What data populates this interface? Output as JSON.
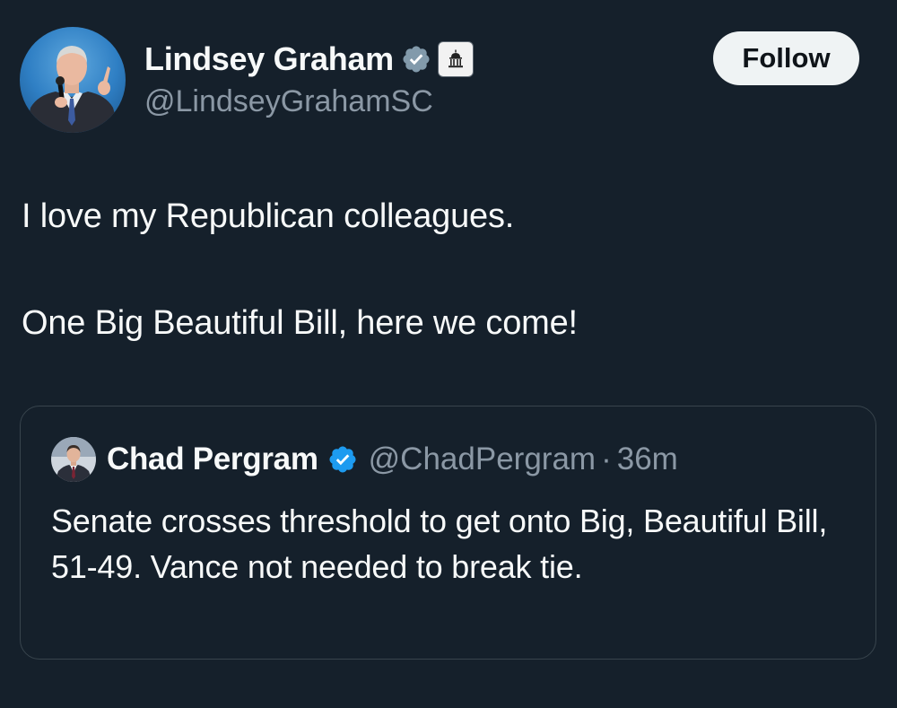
{
  "tweet": {
    "author": {
      "display_name": "Lindsey Graham",
      "handle": "@LindseyGrahamSC",
      "verified": true,
      "badge_icon": "capitol-building-icon"
    },
    "follow_label": "Follow",
    "text_lines": [
      "I love my Republican colleagues.",
      "One Big Beautiful Bill, here we come!"
    ]
  },
  "quoted": {
    "author": {
      "display_name": "Chad Pergram",
      "handle": "@ChadPergram",
      "verified": true
    },
    "separator": "·",
    "time": "36m",
    "text": "Senate crosses threshold to get onto Big, Beautiful Bill, 51-49. Vance not needed to break tie."
  },
  "colors": {
    "background": "#15202b",
    "verified_gray": "#829aab",
    "verified_blue": "#1d9bf0",
    "secondary_text": "#8b98a5",
    "border": "#38444d"
  }
}
